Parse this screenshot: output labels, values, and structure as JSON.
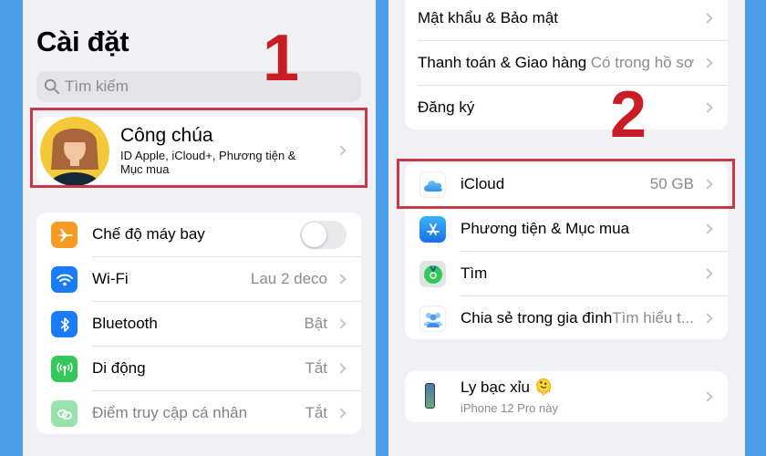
{
  "left": {
    "title": "Cài đặt",
    "search": {
      "placeholder": "Tìm kiếm",
      "icon": "search-icon"
    },
    "profile": {
      "name": "Công chúa",
      "subtitle": "ID Apple, iCloud+, Phương tiện & Mục mua",
      "icon": "avatar"
    },
    "annotation_number": "1",
    "settings": [
      {
        "label": "Chế độ máy bay",
        "icon": "airplane-icon",
        "color": "#f59a23",
        "control": "toggle",
        "toggle_on": false
      },
      {
        "label": "Wi-Fi",
        "value": "Lau 2 deco",
        "icon": "wifi-icon",
        "color": "#1a7cf5"
      },
      {
        "label": "Bluetooth",
        "value": "Bật",
        "icon": "bluetooth-icon",
        "color": "#1a7cf5"
      },
      {
        "label": "Di động",
        "value": "Tắt",
        "icon": "cellular-antenna-icon",
        "color": "#34c759"
      },
      {
        "label": "Điểm truy cập cá nhân",
        "value": "Tắt",
        "icon": "personal-hotspot-icon",
        "color": "#34c759",
        "disabled": true
      }
    ]
  },
  "right": {
    "annotation_number": "2",
    "account_group": [
      {
        "label": "Mật khẩu & Bảo mật"
      },
      {
        "label": "Thanh toán & Giao hàng",
        "value": "Có trong hồ sơ"
      },
      {
        "label": "Đăng ký"
      }
    ],
    "services_group": [
      {
        "label": "iCloud",
        "value": "50 GB",
        "icon": "icloud-icon"
      },
      {
        "label": "Phương tiện & Mục mua",
        "icon": "app-store-icon"
      },
      {
        "label": "Tìm",
        "icon": "find-my-icon"
      },
      {
        "label": "Chia sẻ trong gia đình",
        "value": "Tìm hiểu t...",
        "icon": "family-sharing-icon"
      }
    ],
    "device": {
      "name": "Ly bạc xỉu",
      "emoji": "🫠",
      "subtitle": "iPhone 12 Pro này",
      "icon": "iphone-icon"
    }
  },
  "colors": {
    "background_blue": "#4d9ee8",
    "highlight_red": "#c63a48",
    "annotation_red": "#c81d25"
  }
}
